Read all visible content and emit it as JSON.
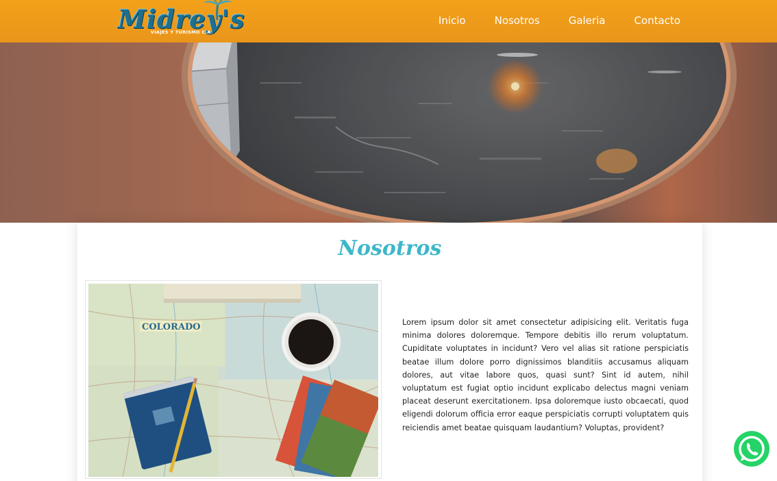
{
  "header": {
    "brand": "Midrey's",
    "brand_sub": "VIAJES Y TURISMO C.A.",
    "nav": [
      {
        "label": "Inicio"
      },
      {
        "label": "Nosotros"
      },
      {
        "label": "Galeria"
      },
      {
        "label": "Contacto"
      }
    ]
  },
  "hero": {
    "image": "airplane-window-view"
  },
  "about": {
    "title": "Nosotros",
    "image": "map-notebook-coffee",
    "paragraph": "Lorem ipsum dolor sit amet consectetur adipisicing elit. Veritatis fuga minima dolores doloremque. Tempore debitis illo rerum voluptatum. Cupiditate voluptates in incidunt? Vero vel alias sit ratione perspiciatis beatae illum dolore porro dignissimos blanditiis accusamus aliquam dolores, aut vitae labore quos, quasi sunt? Sint id autem, nihil voluptatum est fugiat optio incidunt explicabo delectus magni veniam placeat deserunt exercitationem. Ipsa doloremque iusto obcaecati, quod eligendi dolorum officia error eaque perspiciatis corrupti voluptatem quis reiciendis amet beatae quisquam laudantium? Voluptas, provident?"
  },
  "floating": {
    "whatsapp_icon": "whatsapp-icon"
  },
  "colors": {
    "navbar": "#f3a11a",
    "title_accent": "#3db7c8",
    "whatsapp": "#25d366"
  }
}
